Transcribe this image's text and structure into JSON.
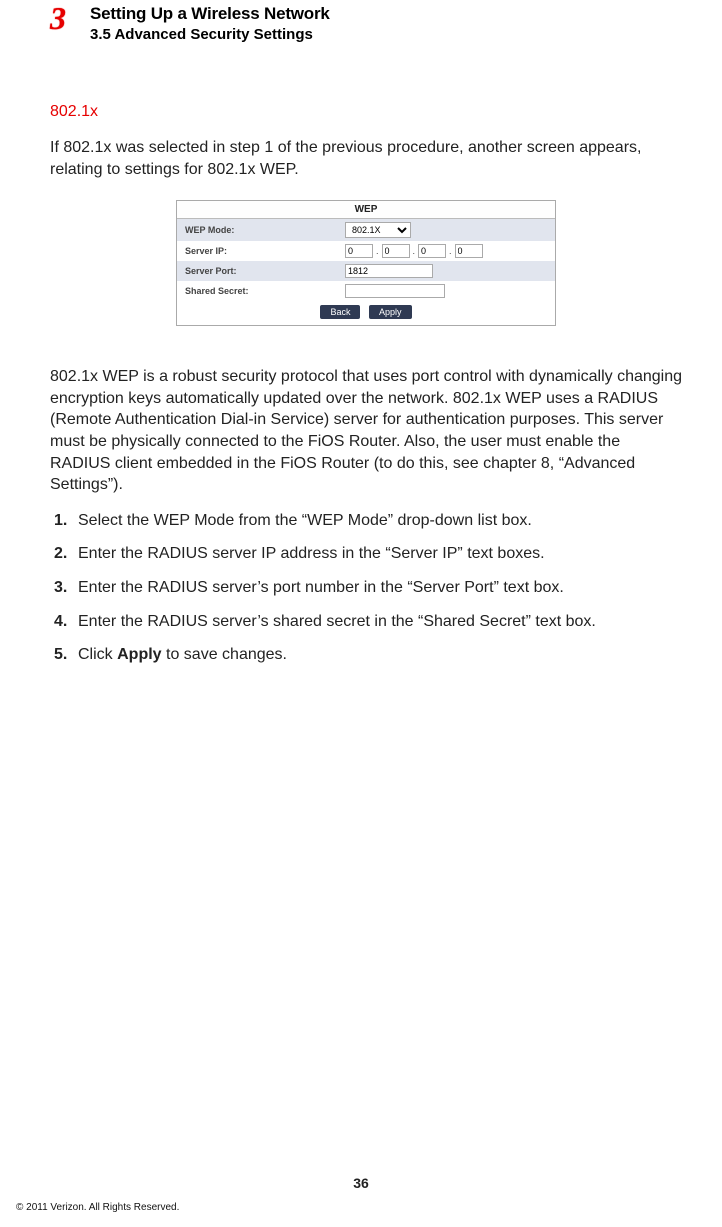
{
  "header": {
    "chapter_number": "3",
    "chapter_title": "Setting Up a Wireless Network",
    "section_number_title": "3.5  Advanced Security Settings"
  },
  "section_heading": "802.1x",
  "intro_paragraph": "If 802.1x was selected in step 1 of the previous procedure, another screen appears, relating to settings for 802.1x WEP.",
  "wep_panel": {
    "title": "WEP",
    "rows": {
      "mode_label": "WEP Mode:",
      "mode_value": "802.1X",
      "server_ip_label": "Server IP:",
      "server_ip_octets": [
        "0",
        "0",
        "0",
        "0"
      ],
      "server_port_label": "Server Port:",
      "server_port_value": "1812",
      "shared_secret_label": "Shared Secret:",
      "shared_secret_value": ""
    },
    "buttons": {
      "back": "Back",
      "apply": "Apply"
    }
  },
  "explain_paragraph": "802.1x WEP is a robust security protocol that uses port control with dynamically changing encryption keys automatically updated over the network. 802.1x WEP uses a RADIUS (Remote Authentication Dial-in Service) server for authentication purposes. This server must be physically connected to the FiOS Router. Also, the user must enable the RADIUS client embedded in the FiOS Router (to do this, see chapter 8, “Advanced Settings”).",
  "steps": [
    {
      "num": "1.",
      "text": "Select the WEP Mode from the “WEP Mode” drop-down list box."
    },
    {
      "num": "2.",
      "text": "Enter the RADIUS server IP address in the “Server IP” text boxes."
    },
    {
      "num": "3.",
      "text": "Enter the RADIUS server’s port number in the “Server Port” text box."
    },
    {
      "num": "4.",
      "text": "Enter the RADIUS server’s shared secret in the “Shared Secret” text box."
    },
    {
      "num": "5.",
      "text_prefix": "Click ",
      "text_bold": "Apply",
      "text_suffix": " to save changes."
    }
  ],
  "page_number": "36",
  "copyright": "© 2011 Verizon. All Rights Reserved."
}
